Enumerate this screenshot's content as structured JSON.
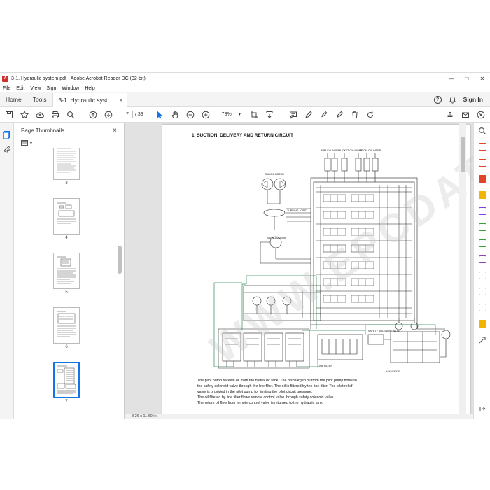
{
  "window": {
    "title": "3-1. Hydraulic system.pdf - Adobe Acrobat Reader DC (32-bit)",
    "minimize": "—",
    "maximize": "□",
    "close": "✕"
  },
  "menu": [
    "File",
    "Edit",
    "View",
    "Sign",
    "Window",
    "Help"
  ],
  "tabs": {
    "home": "Home",
    "tools": "Tools",
    "document": "3-1. Hydraulic syst...",
    "close": "×",
    "help_glyph": "?",
    "sign_in": "Sign In"
  },
  "toolbar": {
    "page_current": "7",
    "page_total": "/ 33",
    "zoom": "73%"
  },
  "thumbnails": {
    "title": "Page Thumbnails",
    "close": "×",
    "pages": [
      "3",
      "4",
      "5",
      "6",
      "7"
    ],
    "active_page": "7"
  },
  "document": {
    "status_size": "8.26 x 11.69 in",
    "heading": "1. SUCTION, DELIVERY AND RETURN CIRCUIT",
    "figure_id": "HX60A03E",
    "watermark": "WWW.EPCDATA.COM",
    "labels": {
      "travel_motor": "TRAVEL MOTOR",
      "swing_motor": "SWING MOTOR",
      "turning_joint": "TURNING JOINT",
      "arm_cylinder": "ARM CYLINDER",
      "bucket_cylinder": "BUCKET CYLINDER",
      "boom_cylinder": "BOOM CYLINDER",
      "line_filter": "LINE FILTER",
      "safety_solenoid": "SAFETY SOLENOID VALVE"
    },
    "paragraph": [
      "The pilot pump receive oil from the hydraulic tank.  The discharged oil from the pilot pump flows to",
      "the safety solenoid valve through the line filter.  The oil is filtered by the line filter.  The pilot relief",
      "valve is provided in the pilot pump for limiting the pilot circuit pressure.",
      "The oil filtered by line filter flows remote control valve through safety solenoid valve.",
      "The return oil flow from remote control valve is returned to the hydraulic tank."
    ]
  },
  "colors": {
    "accent": "#1473e6",
    "acrobat_red": "#d32f2f",
    "panel_bg": "#f4f4f4",
    "doc_bg": "#e2e2e2"
  }
}
